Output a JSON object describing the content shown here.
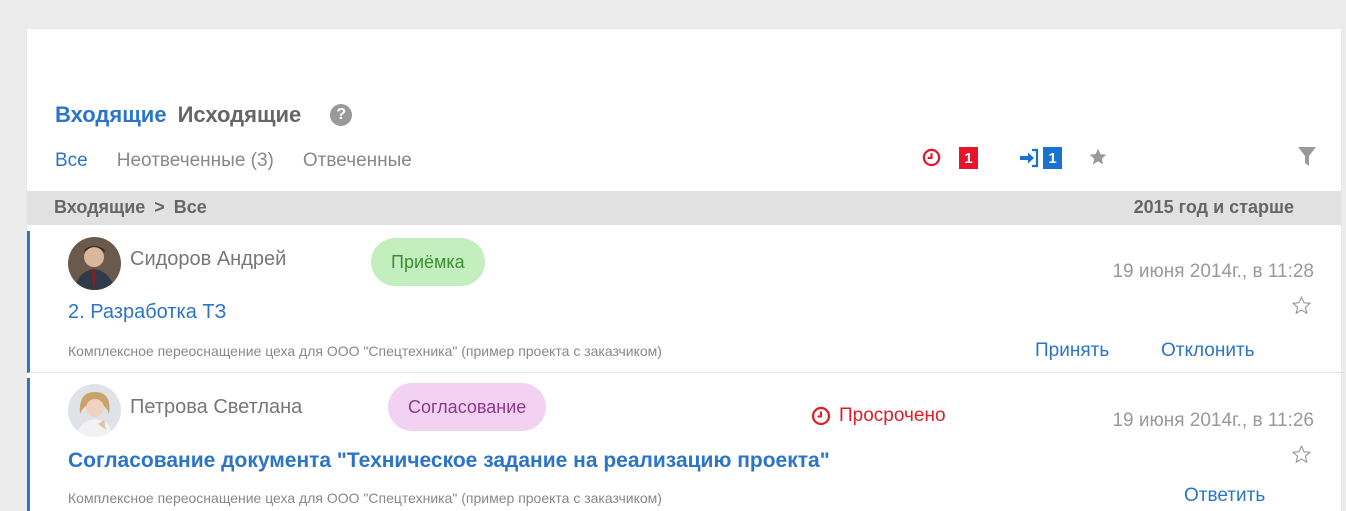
{
  "main_tabs": {
    "incoming": "Входящие",
    "outgoing": "Исходящие"
  },
  "help_icon": "?",
  "sub_tabs": {
    "all": "Все",
    "unanswered": "Неотвеченные (3)",
    "answered": "Отвеченные"
  },
  "tools": {
    "overdue_count": "1",
    "incoming_count": "1"
  },
  "breadcrumb": {
    "root": "Входящие",
    "separator": ">",
    "current": "Все"
  },
  "period": "2015 год и старше",
  "messages": [
    {
      "author": "Сидоров Андрей",
      "tag": "Приёмка",
      "date": "19 июня 2014г., в 11:28",
      "title": "2. Разработка ТЗ",
      "project": "Комплексное переоснащение цеха для ООО \"Спецтехника\" (пример проекта с заказчиком)",
      "actions": [
        "Принять",
        "Отклонить"
      ]
    },
    {
      "author": "Петрова Светлана",
      "tag": "Согласование",
      "status": "Просрочено",
      "date": "19 июня 2014г., в 11:26",
      "title": "Согласование документа \"Техническое задание на реализацию проекта\"",
      "project": "Комплексное переоснащение цеха для ООО \"Спецтехника\" (пример проекта с заказчиком)",
      "actions": [
        "Ответить"
      ]
    }
  ],
  "colors": {
    "accent": "#2b74c7",
    "alert": "#e8142b",
    "tag_green": "#c3eebd",
    "tag_pink": "#f3d1f3"
  }
}
